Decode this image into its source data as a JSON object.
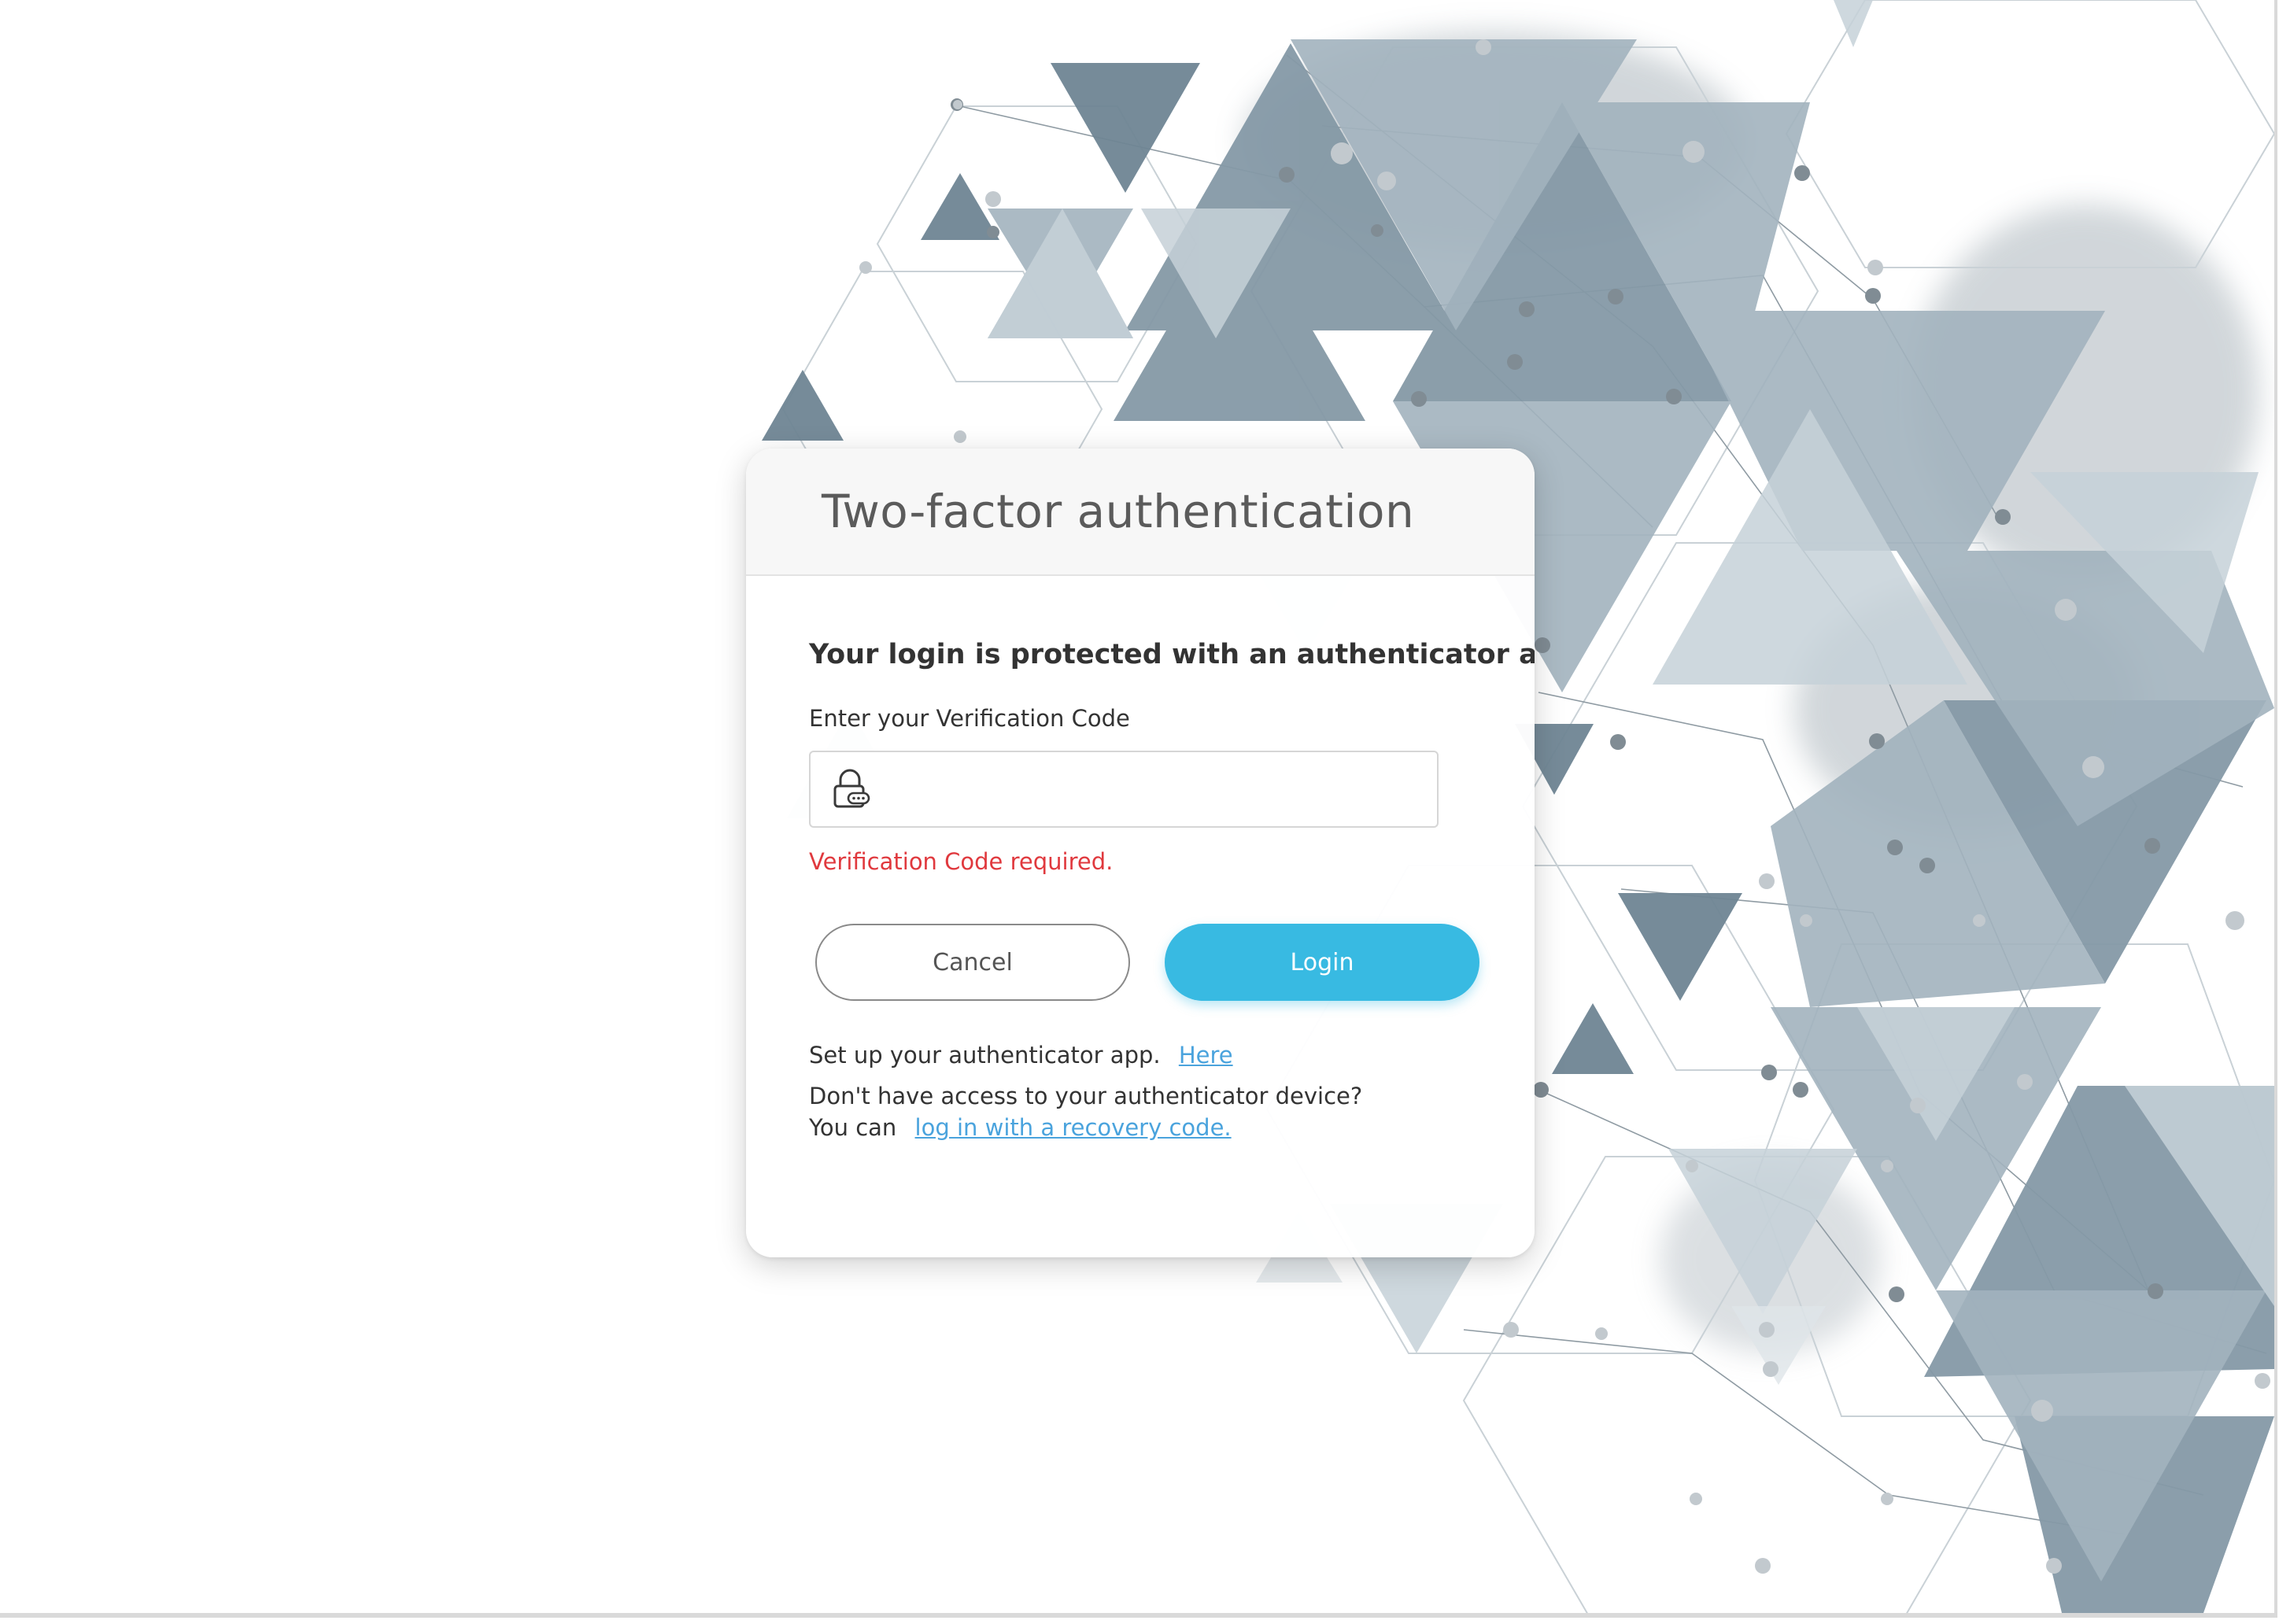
{
  "dialog": {
    "title": "Two-factor authentication",
    "lead": "Your login is protected with an authenticator app.",
    "field_label": "Enter your Verification Code",
    "input_value": "",
    "input_placeholder": "",
    "error": "Verification Code required.",
    "cancel_label": "Cancel",
    "login_label": "Login",
    "setup_text": "Set up your authenticator app.",
    "setup_link": "Here",
    "no_access_text": "Don't have access to your authenticator device?",
    "recovery_prefix": "You can",
    "recovery_link": "log in with a recovery code."
  },
  "icons": {
    "input_icon": "lock-icon"
  },
  "colors": {
    "primary": "#38bae2",
    "error": "#e0393e",
    "link": "#4aa3dd",
    "title": "#5b5b5b",
    "triangle_dark": "#6f8594",
    "triangle_mid": "#93a6b2",
    "triangle_light": "#c5d0d7"
  }
}
